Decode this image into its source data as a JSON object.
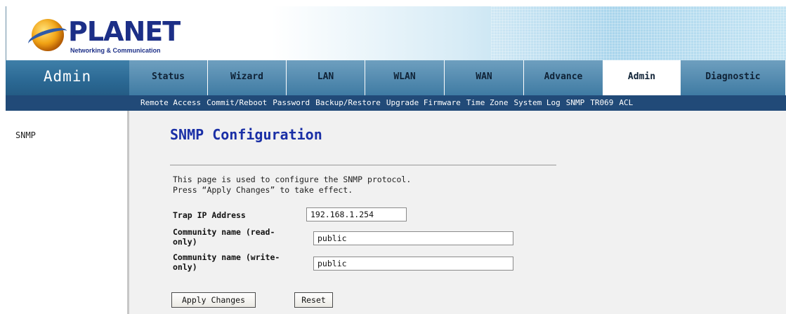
{
  "brand": {
    "name": "PLANET",
    "tagline": "Networking & Communication"
  },
  "nav": {
    "section_title": "Admin",
    "tabs": [
      {
        "label": "Status"
      },
      {
        "label": "Wizard"
      },
      {
        "label": "LAN"
      },
      {
        "label": "WLAN"
      },
      {
        "label": "WAN"
      },
      {
        "label": "Advance"
      },
      {
        "label": "Admin",
        "active": true
      },
      {
        "label": "Diagnostic"
      }
    ]
  },
  "subnav": {
    "items": [
      {
        "label": "Remote Access"
      },
      {
        "label": "Commit/Reboot"
      },
      {
        "label": "Password"
      },
      {
        "label": "Backup/Restore"
      },
      {
        "label": "Upgrade Firmware"
      },
      {
        "label": "Time Zone"
      },
      {
        "label": "System Log"
      },
      {
        "label": "SNMP"
      },
      {
        "label": "TR069"
      },
      {
        "label": "ACL"
      }
    ]
  },
  "sidebar": {
    "items": [
      {
        "label": "SNMP"
      }
    ]
  },
  "main": {
    "title": "SNMP Configuration",
    "description_line1": "This page is used to configure the SNMP protocol.",
    "description_line2": "Press “Apply Changes” to take effect.",
    "fields": {
      "trap_ip": {
        "label": "Trap IP Address",
        "value": "192.168.1.254"
      },
      "community_read": {
        "label_line1": "Community name (read-",
        "label_line2": "only)",
        "value": "public"
      },
      "community_write": {
        "label_line1": "Community name (write-",
        "label_line2": "only)",
        "value": "public"
      }
    },
    "buttons": {
      "apply": "Apply Changes",
      "reset": "Reset"
    }
  },
  "colors": {
    "title_blue": "#1a2fa6",
    "nav_dark": "#214a78",
    "nav_mid": "#2c6a95",
    "content_bg": "#f1f1f1"
  }
}
